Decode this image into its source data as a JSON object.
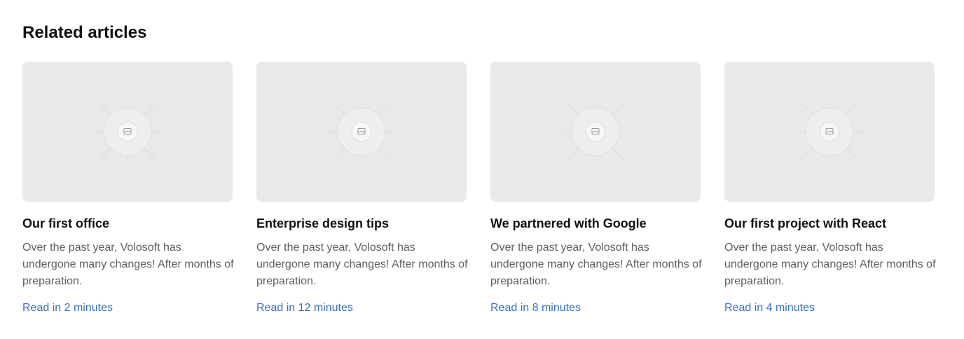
{
  "section": {
    "title": "Related articles"
  },
  "cards": [
    {
      "title": "Our first office",
      "description": "Over the past year, Volosoft has undergone many changes! After months of preparation.",
      "link": "Read in 2 minutes"
    },
    {
      "title": "Enterprise design tips",
      "description": "Over the past year, Volosoft has undergone many changes! After months of preparation.",
      "link": "Read in 12 minutes"
    },
    {
      "title": "We partnered with Google",
      "description": "Over the past year, Volosoft has undergone many changes! After months of preparation.",
      "link": "Read in 8 minutes"
    },
    {
      "title": "Our first project with React",
      "description": "Over the past year, Volosoft has undergone many changes! After months of preparation.",
      "link": "Read in 4 minutes"
    }
  ],
  "icons": {
    "thumbnail": "image-placeholder-icon"
  },
  "colors": {
    "link": "#3a6fc3",
    "description": "#5b5f66",
    "thumbnail_bg": "#e9e9e9"
  }
}
